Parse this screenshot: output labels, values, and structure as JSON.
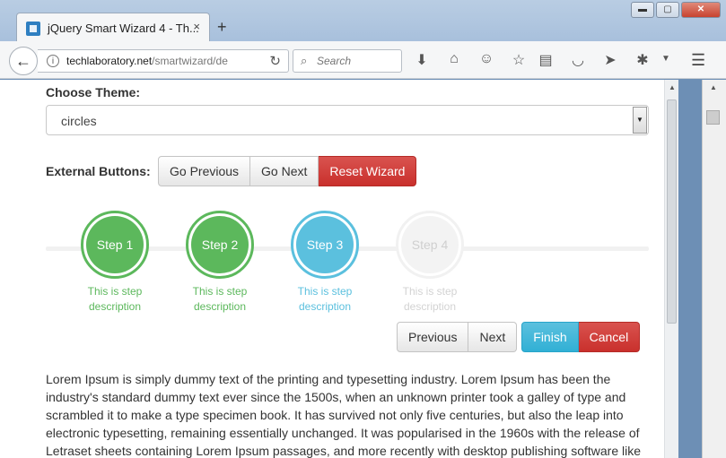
{
  "browser": {
    "tab_title": "jQuery Smart Wizard 4 - Th...",
    "tab_close": "×",
    "new_tab": "+",
    "url_host": "techlaboratory.net",
    "url_path": "/smartwizard/de",
    "search_placeholder": "Search",
    "window_buttons": {
      "minimize": "▬",
      "maximize": "▢",
      "close": "✕"
    }
  },
  "page": {
    "theme_label": "Choose Theme:",
    "theme_value": "circles",
    "external_label": "External Buttons:",
    "external_buttons": {
      "previous": "Go Previous",
      "next": "Go Next",
      "reset": "Reset Wizard"
    },
    "steps": [
      {
        "label": "Step 1",
        "desc1": "This is step",
        "desc2": "description",
        "state": "done"
      },
      {
        "label": "Step 2",
        "desc1": "This is step",
        "desc2": "description",
        "state": "done"
      },
      {
        "label": "Step 3",
        "desc1": "This is step",
        "desc2": "description",
        "state": "active"
      },
      {
        "label": "Step 4",
        "desc1": "This is step",
        "desc2": "description",
        "state": "pending"
      }
    ],
    "wizard_buttons": {
      "previous": "Previous",
      "next": "Next",
      "finish": "Finish",
      "cancel": "Cancel"
    },
    "paragraph": "Lorem Ipsum is simply dummy text of the printing and typesetting industry. Lorem Ipsum has been the industry's standard dummy text ever since the 1500s, when an unknown printer took a galley of type and scrambled it to make a type specimen book. It has survived not only five centuries, but also the leap into electronic typesetting, remaining essentially unchanged. It was popularised in the 1960s with the release of Letraset sheets containing Lorem Ipsum passages, and more recently with desktop publishing software like"
  },
  "colors": {
    "done": "#5cb85c",
    "active": "#5bc0de",
    "pending": "#f1f1f1",
    "danger": "#d9534f"
  }
}
